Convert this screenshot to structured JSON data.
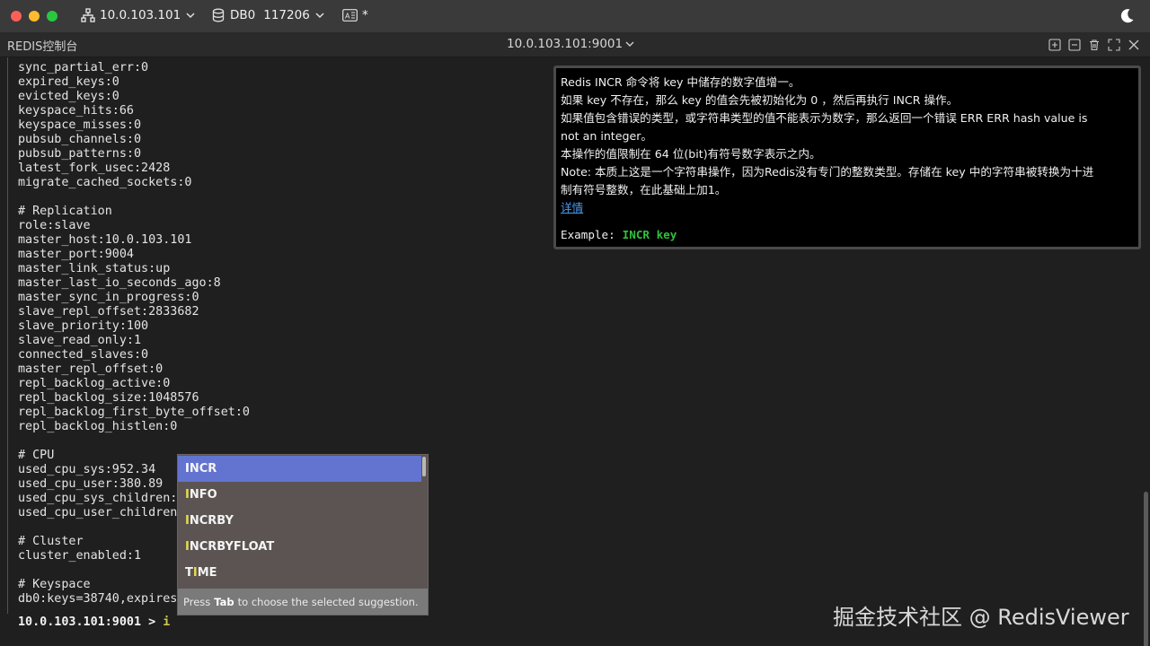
{
  "titlebar": {
    "host": "10.0.103.101",
    "db": "DB0",
    "db_count": "117206",
    "mode_label": "*"
  },
  "tabbar": {
    "app_name": "REDIS控制台",
    "connection": "10.0.103.101:9001"
  },
  "output_lines": [
    "sync_partial_err:0",
    "expired_keys:0",
    "evicted_keys:0",
    "keyspace_hits:66",
    "keyspace_misses:0",
    "pubsub_channels:0",
    "pubsub_patterns:0",
    "latest_fork_usec:2428",
    "migrate_cached_sockets:0",
    "",
    "# Replication",
    "role:slave",
    "master_host:10.0.103.101",
    "master_port:9004",
    "master_link_status:up",
    "master_last_io_seconds_ago:8",
    "master_sync_in_progress:0",
    "slave_repl_offset:2833682",
    "slave_priority:100",
    "slave_read_only:1",
    "connected_slaves:0",
    "master_repl_offset:0",
    "repl_backlog_active:0",
    "repl_backlog_size:1048576",
    "repl_backlog_first_byte_offset:0",
    "repl_backlog_histlen:0",
    "",
    "# CPU",
    "used_cpu_sys:952.34",
    "used_cpu_user:380.89",
    "used_cpu_sys_children:",
    "used_cpu_user_children:",
    "",
    "# Cluster",
    "cluster_enabled:1",
    "",
    "# Keyspace",
    "db0:keys=38740,expires="
  ],
  "prompt": {
    "text": "10.0.103.101:9001 > ",
    "typed": "i"
  },
  "doc": {
    "lines": [
      "Redis INCR 命令将 key 中储存的数字值增一。",
      "如果 key 不存在，那么 key 的值会先被初始化为 0 ，然后再执行 INCR 操作。",
      "如果值包含错误的类型，或字符串类型的值不能表示为数字，那么返回一个错误 ERR ERR hash value is",
      "not an integer。",
      "本操作的值限制在 64 位(bit)有符号数字表示之内。",
      "Note: 本质上这是一个字符串操作，因为Redis没有专门的整数类型。存储在 key 中的字符串被转换为十进",
      "制有符号整数，在此基础上加1。"
    ],
    "link": "详情",
    "example_label": "Example:",
    "example_cmd": "INCR key"
  },
  "suggestions": {
    "items": [
      {
        "hl": "I",
        "rest": "NCR"
      },
      {
        "hl": "I",
        "rest": "NFO"
      },
      {
        "hl": "I",
        "rest": "NCRBY"
      },
      {
        "hl": "I",
        "rest": "NCRBYFLOAT"
      },
      {
        "pre": "T",
        "hl": "I",
        "rest": "ME"
      }
    ],
    "footer_pre": "Press",
    "footer_key": "Tab",
    "footer_post": "to choose the selected suggestion."
  },
  "watermark": "掘金技术社区 @ RedisViewer"
}
